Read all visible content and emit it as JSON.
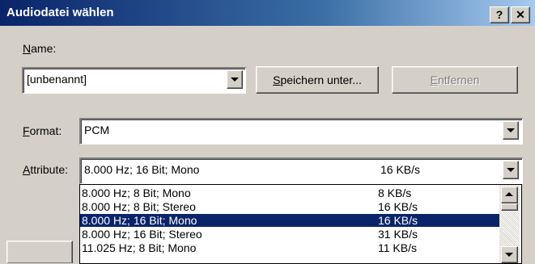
{
  "window": {
    "title": "Audiodatei wählen",
    "help_label": "?",
    "close_label": "✕"
  },
  "name": {
    "label_mnemonic": "N",
    "label_rest": "ame:",
    "value": "[unbenannt]"
  },
  "buttons": {
    "save_as_mnemonic": "S",
    "save_as_rest": "peichern unter...",
    "remove_mnemonic": "E",
    "remove_rest": "ntfernen"
  },
  "format": {
    "label_mnemonic": "F",
    "label_rest": "ormat:",
    "value": "PCM"
  },
  "attribute": {
    "label_mnemonic": "A",
    "label_rest": "ttribute:",
    "value_rate": "8.000 Hz; 16 Bit; Mono",
    "value_size": "16 KB/s"
  },
  "attribute_options": [
    {
      "rate": "8.000 Hz; 8 Bit; Mono",
      "size": "8 KB/s",
      "selected": false
    },
    {
      "rate": "8.000 Hz; 8 Bit; Stereo",
      "size": "16 KB/s",
      "selected": false
    },
    {
      "rate": "8.000 Hz; 16 Bit; Mono",
      "size": "16 KB/s",
      "selected": true
    },
    {
      "rate": "8.000 Hz; 16 Bit; Stereo",
      "size": "31 KB/s",
      "selected": false
    },
    {
      "rate": "11.025 Hz; 8 Bit; Mono",
      "size": "11 KB/s",
      "selected": false
    }
  ],
  "colors": {
    "titlebar": "#0a246a",
    "face": "#d4d0c8",
    "selection": "#0a246a"
  }
}
